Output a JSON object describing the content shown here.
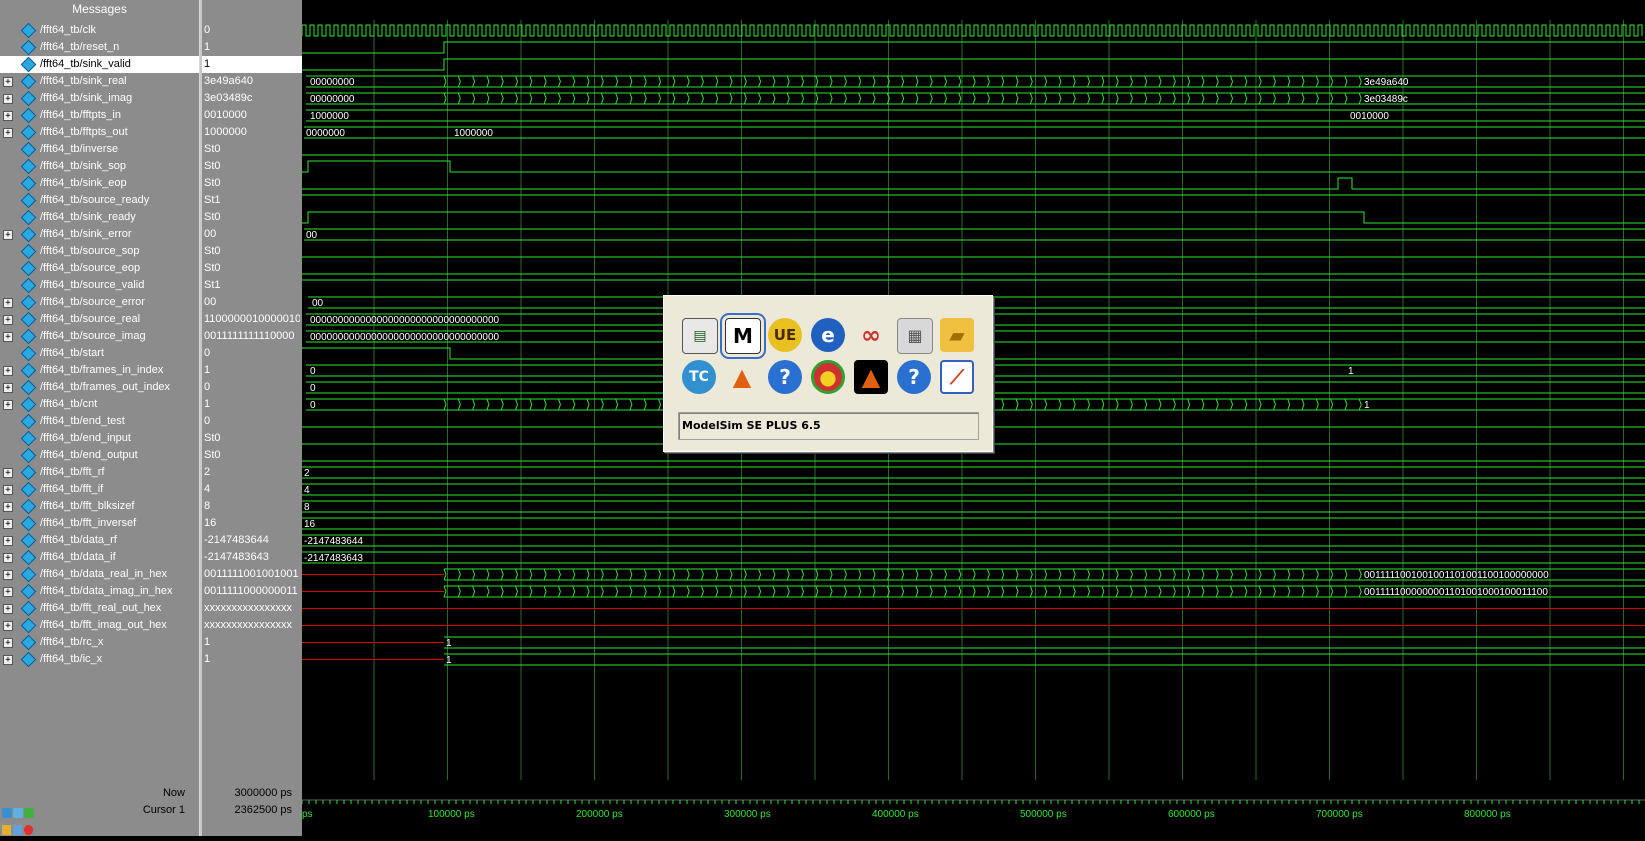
{
  "header": {
    "messages_label": "Messages"
  },
  "signals": [
    {
      "name": "/fft64_tb/clk",
      "value": "0",
      "expand": false
    },
    {
      "name": "/fft64_tb/reset_n",
      "value": "1",
      "expand": false
    },
    {
      "name": "/fft64_tb/sink_valid",
      "value": "1",
      "expand": false,
      "selected": true
    },
    {
      "name": "/fft64_tb/sink_real",
      "value": "3e49a640",
      "expand": true
    },
    {
      "name": "/fft64_tb/sink_imag",
      "value": "3e03489c",
      "expand": true
    },
    {
      "name": "/fft64_tb/fftpts_in",
      "value": "0010000",
      "expand": true
    },
    {
      "name": "/fft64_tb/fftpts_out",
      "value": "1000000",
      "expand": true
    },
    {
      "name": "/fft64_tb/inverse",
      "value": "St0",
      "expand": false
    },
    {
      "name": "/fft64_tb/sink_sop",
      "value": "St0",
      "expand": false
    },
    {
      "name": "/fft64_tb/sink_eop",
      "value": "St0",
      "expand": false
    },
    {
      "name": "/fft64_tb/source_ready",
      "value": "St1",
      "expand": false
    },
    {
      "name": "/fft64_tb/sink_ready",
      "value": "St0",
      "expand": false
    },
    {
      "name": "/fft64_tb/sink_error",
      "value": "00",
      "expand": true
    },
    {
      "name": "/fft64_tb/source_sop",
      "value": "St0",
      "expand": false
    },
    {
      "name": "/fft64_tb/source_eop",
      "value": "St0",
      "expand": false
    },
    {
      "name": "/fft64_tb/source_valid",
      "value": "St1",
      "expand": false
    },
    {
      "name": "/fft64_tb/source_error",
      "value": "00",
      "expand": true
    },
    {
      "name": "/fft64_tb/source_real",
      "value": "1100000010000010",
      "expand": true
    },
    {
      "name": "/fft64_tb/source_imag",
      "value": "0011111111110000",
      "expand": true
    },
    {
      "name": "/fft64_tb/start",
      "value": "0",
      "expand": false
    },
    {
      "name": "/fft64_tb/frames_in_index",
      "value": "1",
      "expand": true
    },
    {
      "name": "/fft64_tb/frames_out_index",
      "value": "0",
      "expand": true
    },
    {
      "name": "/fft64_tb/cnt",
      "value": "1",
      "expand": true
    },
    {
      "name": "/fft64_tb/end_test",
      "value": "0",
      "expand": false
    },
    {
      "name": "/fft64_tb/end_input",
      "value": "St0",
      "expand": false
    },
    {
      "name": "/fft64_tb/end_output",
      "value": "St0",
      "expand": false
    },
    {
      "name": "/fft64_tb/fft_rf",
      "value": "2",
      "expand": true
    },
    {
      "name": "/fft64_tb/fft_if",
      "value": "4",
      "expand": true
    },
    {
      "name": "/fft64_tb/fft_blksizef",
      "value": "8",
      "expand": true
    },
    {
      "name": "/fft64_tb/fft_inversef",
      "value": "16",
      "expand": true
    },
    {
      "name": "/fft64_tb/data_rf",
      "value": "-2147483644",
      "expand": true
    },
    {
      "name": "/fft64_tb/data_if",
      "value": "-2147483643",
      "expand": true
    },
    {
      "name": "/fft64_tb/data_real_in_hex",
      "value": "0011111001001001",
      "expand": true
    },
    {
      "name": "/fft64_tb/data_imag_in_hex",
      "value": "0011111000000011",
      "expand": true
    },
    {
      "name": "/fft64_tb/fft_real_out_hex",
      "value": "xxxxxxxxxxxxxxxx",
      "expand": true
    },
    {
      "name": "/fft64_tb/fft_imag_out_hex",
      "value": "xxxxxxxxxxxxxxxx",
      "expand": true
    },
    {
      "name": "/fft64_tb/rc_x",
      "value": "1",
      "expand": true
    },
    {
      "name": "/fft64_tb/ic_x",
      "value": "1",
      "expand": true
    }
  ],
  "wave_labels": {
    "sink_real_start": "00000000",
    "sink_real_end": "3e49a640",
    "sink_imag_start": "00000000",
    "sink_imag_end": "3e03489c",
    "fftpts_in_start": "1000000",
    "fftpts_in_end": "0010000",
    "fftpts_out_start": "0000000",
    "fftpts_out_end": "1000000",
    "sink_error": "00",
    "source_error": "00",
    "source_real": "0000000000000000000000000000000000",
    "source_imag": "0000000000000000000000000000000000",
    "frames_in_start": "0",
    "frames_in_end": "1",
    "frames_out": "0",
    "cnt_start": "0",
    "cnt_end": "1",
    "fft_rf": "2",
    "fft_if": "4",
    "fft_blksizef": "8",
    "fft_inversef": "16",
    "data_rf": "-2147483644",
    "data_if": "-2147483643",
    "data_real_end": "0011111001001001101001100100000000",
    "data_imag_end": "0011111000000001101001000100011100",
    "rc_x": "1",
    "ic_x": "1"
  },
  "status": {
    "now_label": "Now",
    "now_value": "3000000 ps",
    "cursor_label": "Cursor 1",
    "cursor_value": "2362500 ps"
  },
  "timeline": {
    "ticks": [
      "ps",
      "100000 ps",
      "200000 ps",
      "300000 ps",
      "400000 ps",
      "500000 ps",
      "600000 ps",
      "700000 ps",
      "800000 ps"
    ]
  },
  "popup": {
    "caption": "ModelSim SE PLUS 6.5",
    "icons": [
      "terminal-icon",
      "modelsim-icon",
      "ultraedit-icon",
      "ie-globe-icon",
      "infinity-icon",
      "calculator-icon",
      "folder-icon",
      "teamviewer-icon",
      "matlab-icon",
      "help-icon",
      "chrome-icon",
      "matlab-dark-icon",
      "help-blue-icon",
      "chart-icon"
    ]
  },
  "colors": {
    "wave": "#2ee62e",
    "undefined": "#e00000",
    "grid": "#2a6a2a",
    "timeline_text": "#2ee62e"
  }
}
